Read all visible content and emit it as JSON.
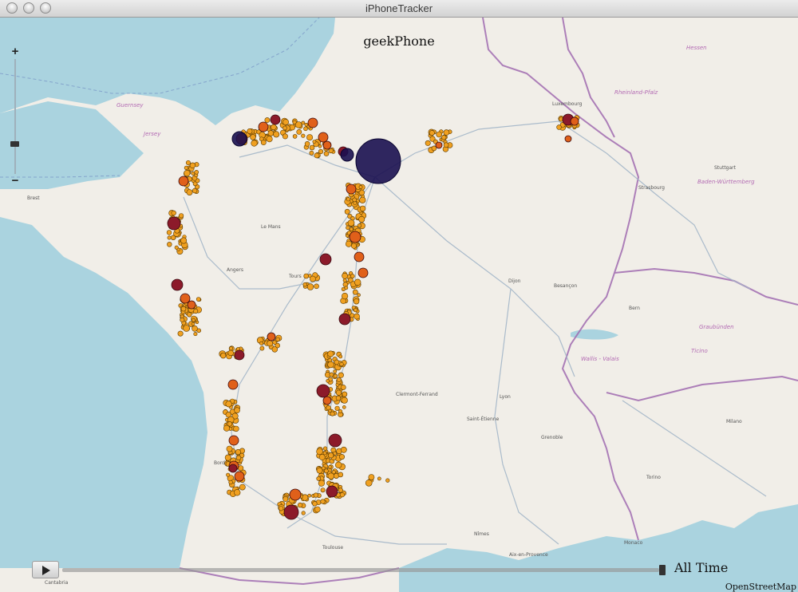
{
  "window": {
    "title": "iPhoneTracker"
  },
  "overlay": {
    "device_name": "geekPhone"
  },
  "zoom": {
    "plus_label": "+",
    "minus_label": "−"
  },
  "timeline": {
    "label": "All Time"
  },
  "attribution": {
    "text": "OpenStreetMap"
  },
  "map_labels": {
    "luxembourg": "Luxembourg",
    "bern": "Bern",
    "monaco": "Monaco",
    "brest": "Brest",
    "bordeaux": "Bordeaux",
    "le_mans": "Le Mans",
    "tours": "Tours",
    "dijon": "Dijon",
    "lyon": "Lyon",
    "clermont_ferrand": "Clermont-Ferrand",
    "toulouse": "Toulouse",
    "angers": "Angers",
    "besancon": "Besançon",
    "grenoble": "Grenoble",
    "saint_etienne": "Saint-Étienne",
    "strasbourg": "Strasbourg",
    "aix_en_provence": "Aix-en-Provence",
    "nimes": "Nîmes",
    "stuttgart": "Stuttgart",
    "torino": "Torino",
    "milano": "Milano",
    "cantabria": "Cantabria",
    "guernsey": "Guernsey",
    "jersey": "Jersey",
    "rheinland_pfalz": "Rheinland-Pfalz",
    "baden_wurttemberg": "Baden-Württemberg",
    "ticino": "Ticino",
    "graubunden": "Graubünden",
    "valais": "Wallis - Valais",
    "hessen": "Hessen"
  },
  "colors": {
    "sea": "#aad3df",
    "land": "#f1eee8",
    "border": "#a06bb0",
    "route": "#a3b6c8",
    "marker_small": "#f0a020",
    "marker_mid": "#e0601a",
    "marker_large": "#8c1a2a",
    "marker_huge": "#1a1050"
  }
}
